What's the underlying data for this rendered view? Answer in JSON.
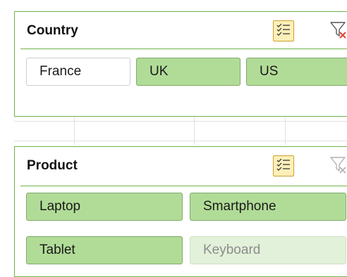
{
  "country_slicer": {
    "title": "Country",
    "multi_select_icon": "multi-select-icon",
    "clear_filter_icon": "clear-filter-icon",
    "clear_filter_active": true,
    "items": [
      {
        "label": "France",
        "state": "unselected"
      },
      {
        "label": "UK",
        "state": "selected"
      },
      {
        "label": "US",
        "state": "selected"
      }
    ]
  },
  "product_slicer": {
    "title": "Product",
    "multi_select_icon": "multi-select-icon",
    "clear_filter_icon": "clear-filter-icon",
    "clear_filter_active": false,
    "items": [
      {
        "label": "Laptop",
        "state": "selected"
      },
      {
        "label": "Smartphone",
        "state": "selected"
      },
      {
        "label": "Tablet",
        "state": "selected"
      },
      {
        "label": "Keyboard",
        "state": "nodata"
      }
    ]
  },
  "colors": {
    "accent_border": "#6fb34a",
    "selected_fill": "#b1dc97",
    "nodata_fill": "#e2f1d9",
    "multi_select_fill": "#fdf0b8",
    "filter_clear_x": "#e0463a"
  }
}
